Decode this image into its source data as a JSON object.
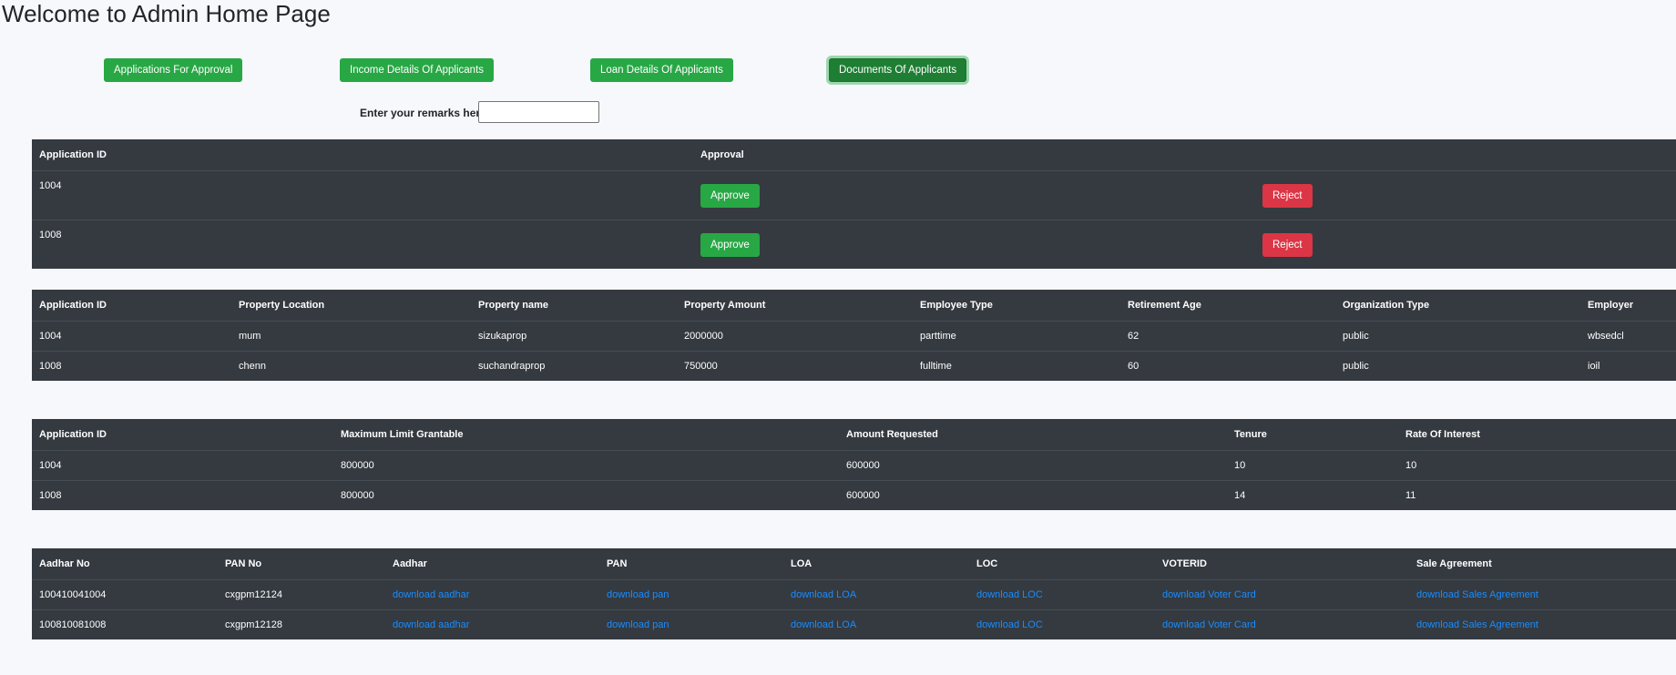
{
  "header": {
    "title": "Welcome to Admin Home Page"
  },
  "nav": {
    "applications": "Applications For Approval",
    "income": "Income Details Of Applicants",
    "loan": "Loan Details Of Applicants",
    "documents": "Documents Of Applicants"
  },
  "remarks": {
    "label": "Enter your remarks here:",
    "value": "",
    "placeholder": ""
  },
  "approval_table": {
    "headers": [
      "Application ID",
      "Approval"
    ],
    "approve_label": "Approve",
    "reject_label": "Reject",
    "rows": [
      {
        "id": "1004"
      },
      {
        "id": "1008"
      }
    ]
  },
  "income_table": {
    "headers": [
      "Application ID",
      "Property Location",
      "Property name",
      "Property Amount",
      "Employee Type",
      "Retirement Age",
      "Organization Type",
      "Employer"
    ],
    "rows": [
      [
        "1004",
        "mum",
        "sizukaprop",
        "2000000",
        "parttime",
        "62",
        "public",
        "wbsedcl"
      ],
      [
        "1008",
        "chenn",
        "suchandraprop",
        "750000",
        "fulltime",
        "60",
        "public",
        "ioil"
      ]
    ]
  },
  "loan_table": {
    "headers": [
      "Application ID",
      "Maximum Limit Grantable",
      "Amount Requested",
      "Tenure",
      "Rate Of Interest"
    ],
    "rows": [
      [
        "1004",
        "800000",
        "600000",
        "10",
        "10"
      ],
      [
        "1008",
        "800000",
        "600000",
        "14",
        "11"
      ]
    ]
  },
  "documents_table": {
    "headers": [
      "Aadhar No",
      "PAN No",
      "Aadhar",
      "PAN",
      "LOA",
      "LOC",
      "VOTERID",
      "Sale Agreement"
    ],
    "rows": [
      [
        "100410041004",
        "cxgpm12124",
        "download aadhar",
        "download pan",
        "download LOA",
        "download LOC",
        "download Voter Card",
        "download Sales Agreement"
      ],
      [
        "100810081008",
        "cxgpm12128",
        "download aadhar",
        "download pan",
        "download LOA",
        "download LOC",
        "download Voter Card",
        "download Sales Agreement"
      ]
    ]
  },
  "colors": {
    "success": "#28a745",
    "danger": "#dc3545",
    "table_dark": "#343a40",
    "link": "#1a8cff"
  }
}
